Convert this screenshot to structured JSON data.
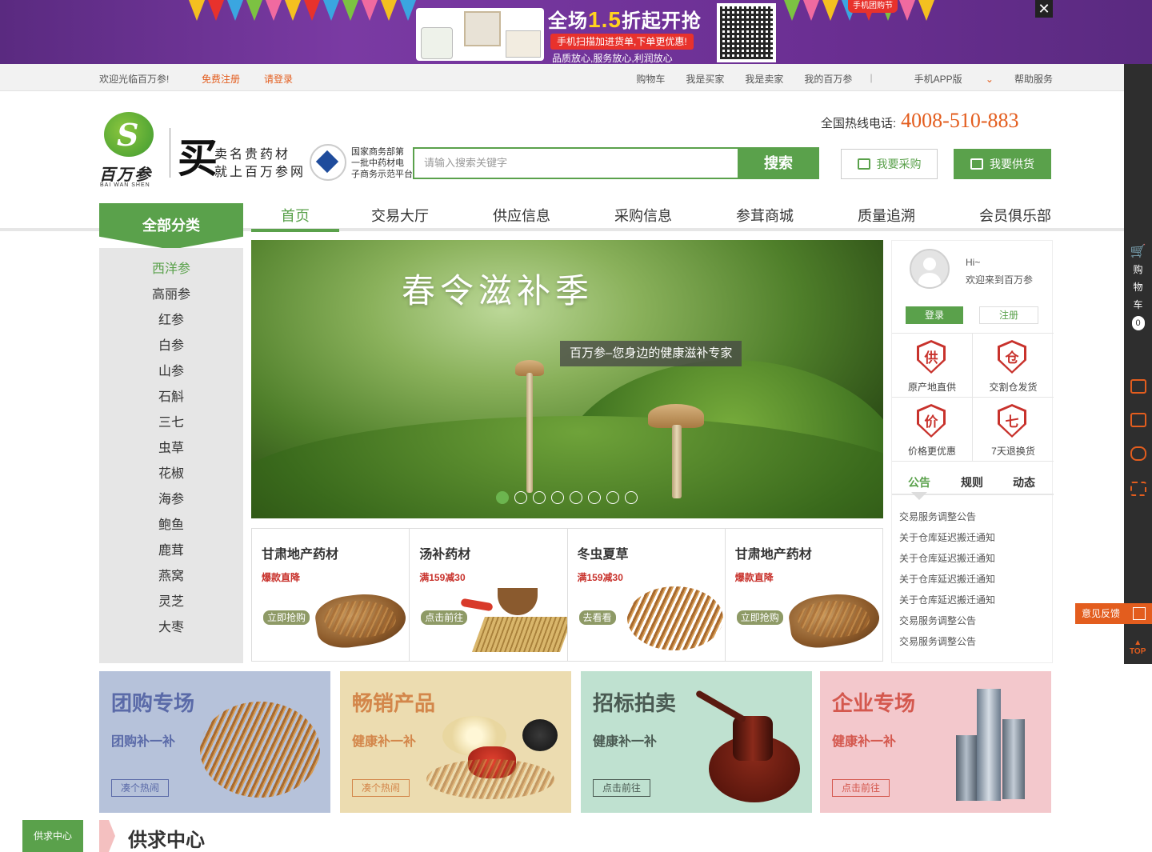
{
  "banner": {
    "title_prefix": "全场",
    "title_num": "1.5",
    "title_suffix": "折起开抢",
    "subtitle": "手机扫描加进货单,下单更优惠!",
    "tagline": "品质放心,服务放心,利润放心",
    "badge": "手机团购节",
    "close_symbol": "✕"
  },
  "topbar": {
    "welcome": "欢迎光临百万参!",
    "register": "免费注册",
    "login": "请登录",
    "links": [
      "购物车",
      "我是买家",
      "我是卖家",
      "我的百万参"
    ],
    "separator": "|",
    "app": "手机APP版",
    "help": "帮助服务"
  },
  "header": {
    "logo_cn": "百万参",
    "logo_en": "BAI WAN SHEN",
    "slogan_big": "买",
    "slogan_line1": "卖名贵药材",
    "slogan_line2": "就上百万参网",
    "gov_line1": "国家商务部第",
    "gov_line2": "一批中药材电",
    "gov_line3": "子商务示范平台",
    "search_placeholder": "请输入搜索关键字",
    "search_button": "搜索",
    "hotline_label": "全国热线电话:",
    "hotline_number": "4008-510-883",
    "buy_button": "我要采购",
    "sell_button": "我要供货"
  },
  "nav": {
    "all_categories": "全部分类",
    "items": [
      "首页",
      "交易大厅",
      "供应信息",
      "采购信息",
      "参茸商城",
      "质量追溯",
      "会员俱乐部"
    ],
    "active_index": 0
  },
  "categories": [
    "西洋参",
    "高丽参",
    "红参",
    "白参",
    "山参",
    "石斛",
    "三七",
    "虫草",
    "花椒",
    "海参",
    "鲍鱼",
    "鹿茸",
    "燕窝",
    "灵芝",
    "大枣"
  ],
  "hero": {
    "title": "春令滋补季",
    "subtitle": "百万参–您身边的健康滋补专家",
    "slide_count": 8,
    "active_slide": 0
  },
  "product_cards": [
    {
      "title": "甘肃地产药材",
      "promo": "爆款直降",
      "button": "立即抢购"
    },
    {
      "title": "汤补药材",
      "promo": "满159减30",
      "button": "点击前往"
    },
    {
      "title": "冬虫夏草",
      "promo": "满159减30",
      "button": "去看看"
    },
    {
      "title": "甘肃地产药材",
      "promo": "爆款直降",
      "button": "立即抢购"
    }
  ],
  "user_panel": {
    "greeting": "Hi~",
    "welcome": "欢迎来到百万参",
    "login": "登录",
    "register": "注册",
    "features": [
      {
        "glyph": "供",
        "label": "原产地直供"
      },
      {
        "glyph": "仓",
        "label": "交割仓发货"
      },
      {
        "glyph": "价",
        "label": "价格更优惠"
      },
      {
        "glyph": "七",
        "label": "7天退换货"
      }
    ],
    "tabs": [
      "公告",
      "规则",
      "动态"
    ],
    "active_tab": 0,
    "notices": [
      "交易服务调整公告",
      "关于仓库延迟搬迁通知",
      "关于仓库延迟搬迁通知",
      "关于仓库延迟搬迁通知",
      "关于仓库延迟搬迁通知",
      "交易服务调整公告",
      "交易服务调整公告"
    ]
  },
  "promo_tiles": [
    {
      "title": "团购专场",
      "subtitle": "团购补一补",
      "button": "凑个热闹",
      "bg": "#b6c2da",
      "color": "#5a6aa8"
    },
    {
      "title": "畅销产品",
      "subtitle": "健康补一补",
      "button": "凑个热闹",
      "bg": "#ecdcb0",
      "color": "#d3864a"
    },
    {
      "title": "招标拍卖",
      "subtitle": "健康补一补",
      "button": "点击前往",
      "bg": "#bfe1d0",
      "color": "#4a5a52"
    },
    {
      "title": "企业专场",
      "subtitle": "健康补一补",
      "button": "点击前往",
      "bg": "#f3c8cc",
      "color": "#d4584e"
    }
  ],
  "bottom": {
    "tab": "供求中心",
    "title": "供求中心"
  },
  "right_bar": {
    "cart_chars": [
      "购",
      "物",
      "车"
    ],
    "cart_count": "0",
    "feedback": "意见反馈",
    "top": "TOP"
  },
  "colors": {
    "brand_green": "#5aa14b",
    "accent_orange": "#e35d1e",
    "promo_red": "#c8322c"
  }
}
